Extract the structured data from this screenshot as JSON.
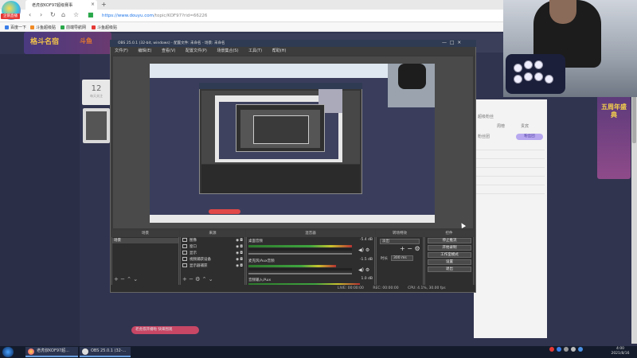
{
  "browser": {
    "logo_badge": "企鹅直播",
    "tab_title": "老虎叔KOF97超级赛事",
    "url_host": "https://www.douyu.com",
    "url_path": "/topic/KOF97?rid=66226",
    "bookmarks": [
      {
        "label": "百度一下",
        "color": "#3a7ee8"
      },
      {
        "label": "斗鱼超级贴",
        "color": "#f08a24"
      },
      {
        "label": "前端导航网",
        "color": "#2aa84a"
      },
      {
        "label": "斗鱼超级贴",
        "color": "#e53935"
      }
    ]
  },
  "site": {
    "logo_main": "格斗名宿",
    "logo_sub": "斗鱼",
    "left_card_number": "12",
    "left_card_caption": "每天关注",
    "right_panel_lines": [
      "超级粉丝",
      "周榜",
      "贵宾",
      "粉丝团"
    ],
    "right_badge": "粉丝团",
    "right_deco_text": "五周年盛典",
    "chat_popup": "老虎叔开播啦 快来围观"
  },
  "obs": {
    "title": "OBS 25.0.1 (32-bit, windows) - 配置文件: 未命名 - 场景: 未命名",
    "menu": [
      "文件(F)",
      "编辑(E)",
      "查看(V)",
      "配置文件(P)",
      "场景集合(S)",
      "工具(T)",
      "帮助(H)"
    ],
    "docks": {
      "scenes": "场景",
      "sources": "来源",
      "mixer": "混音器",
      "transitions": "转场特效",
      "controls": "控件"
    },
    "scenes": [
      "场景"
    ],
    "sources": [
      "图像",
      "窗口",
      "显示",
      "视频捕获设备",
      "显示器捕获"
    ],
    "mixer": [
      {
        "name": "桌面音频",
        "db": "-5.4 dB"
      },
      {
        "name": "麦克风/Aux音频",
        "db": "-1.5 dB"
      },
      {
        "name": "音频输入/Aux",
        "db": "1.0 dB"
      }
    ],
    "transition_select": "淡出",
    "duration_label": "时长",
    "duration_value": "300 ms",
    "controls": [
      "停止推流",
      "开始录制",
      "工作室模式",
      "设置",
      "退出"
    ],
    "status": {
      "live": "LIVE: 00:00:00",
      "rec": "REC: 00:00:00",
      "cpu": "CPU: 4.1%, 30.00 fps"
    }
  },
  "taskbar": {
    "items": [
      "老虎叔KOF97超...",
      "OBS 25.0.1 (32-..."
    ],
    "time": "4:00",
    "date": "2021/8/16"
  }
}
